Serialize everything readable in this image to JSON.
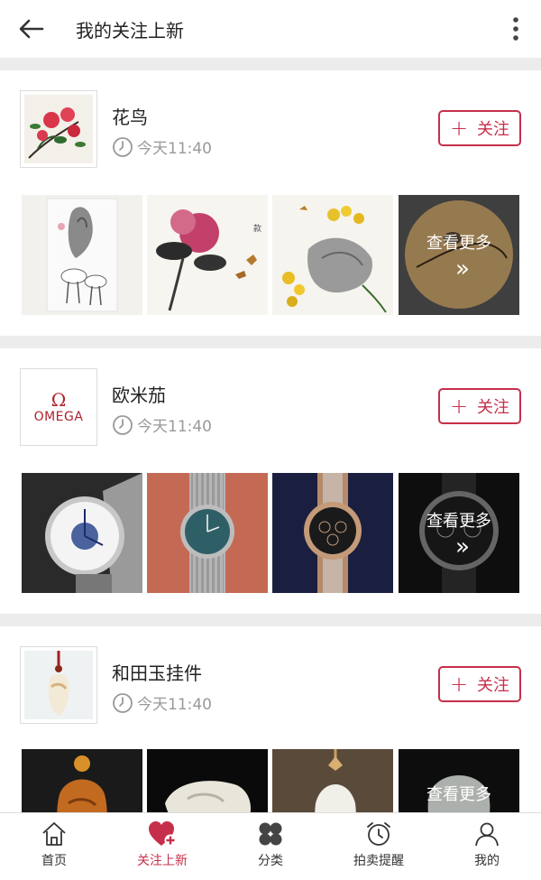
{
  "header": {
    "title": "我的关注上新",
    "back_icon": "arrow-left-icon",
    "more_icon": "vertical-dots-icon"
  },
  "shops": [
    {
      "name": "花鸟",
      "time": "今天11:40",
      "follow_label": "关注",
      "more_label": "查看更多",
      "more_chevron": "»"
    },
    {
      "name": "欧米茄",
      "time": "今天11:40",
      "follow_label": "关注",
      "logo_symbol": "Ω",
      "logo_text": "OMEGA",
      "more_label": "查看更多",
      "more_chevron": "»"
    },
    {
      "name": "和田玉挂件",
      "time": "今天11:40",
      "follow_label": "关注",
      "more_label": "查看更多"
    }
  ],
  "tabbar": {
    "items": [
      {
        "label": "首页",
        "icon": "home-icon"
      },
      {
        "label": "关注上新",
        "icon": "heart-plus-icon",
        "active": true
      },
      {
        "label": "分类",
        "icon": "clover-icon"
      },
      {
        "label": "拍卖提醒",
        "icon": "alarm-clock-icon"
      },
      {
        "label": "我的",
        "icon": "user-icon"
      }
    ]
  },
  "colors": {
    "accent": "#c62f4b",
    "separator": "#ececec",
    "muted_text": "#999999"
  }
}
